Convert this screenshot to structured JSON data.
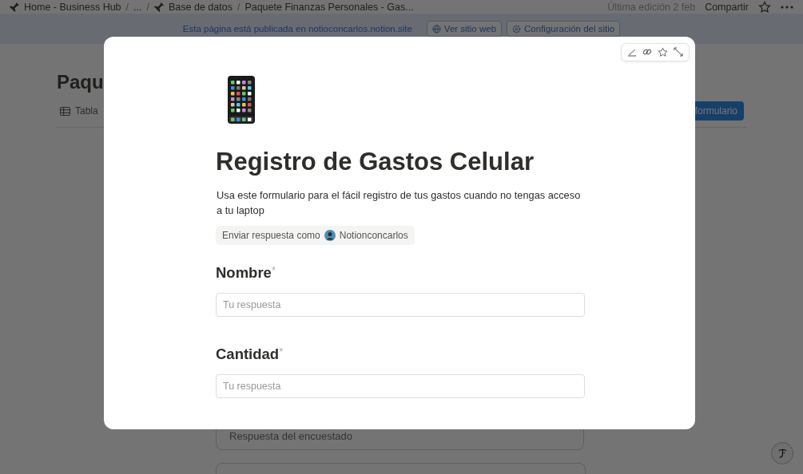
{
  "breadcrumb": [
    {
      "kind": "link",
      "label": "Home - Business Hub",
      "icon": true
    },
    {
      "kind": "separator",
      "label": "/"
    },
    {
      "kind": "link",
      "label": "...",
      "icon": false
    },
    {
      "kind": "separator",
      "label": "/"
    },
    {
      "kind": "link",
      "label": "Base de datos",
      "icon": true
    },
    {
      "kind": "separator",
      "label": "/"
    },
    {
      "kind": "link",
      "label": "Paquete Finanzas Personales - Gas...",
      "icon": false
    }
  ],
  "top_actions": {
    "edited": "Última edición 2 feb",
    "share": "Compartir"
  },
  "publish_banner": {
    "text": "Esta página está publicada en notioconcarlos.notion.site",
    "buttons": [
      "Ver sitio web",
      "Configuración del sitio"
    ]
  },
  "page": {
    "title": "Paqu",
    "view_tab": "Tabla",
    "form_button": "formulario",
    "background_field": "Respuesta del encuestado"
  },
  "modal": {
    "title": "Registro de Gastos Celular",
    "description": "Usa este formulario para el fácil registro de tus gastos cuando no tengas acceso a tu laptop",
    "respond_as": {
      "label": "Enviar respuesta como",
      "user": "Notionconcarlos"
    },
    "questions": [
      {
        "label": "Nombre",
        "required_mark": "*",
        "placeholder": "Tu respuesta"
      },
      {
        "label": "Cantidad",
        "required_mark": "*",
        "placeholder": "Tu respuesta"
      }
    ]
  }
}
